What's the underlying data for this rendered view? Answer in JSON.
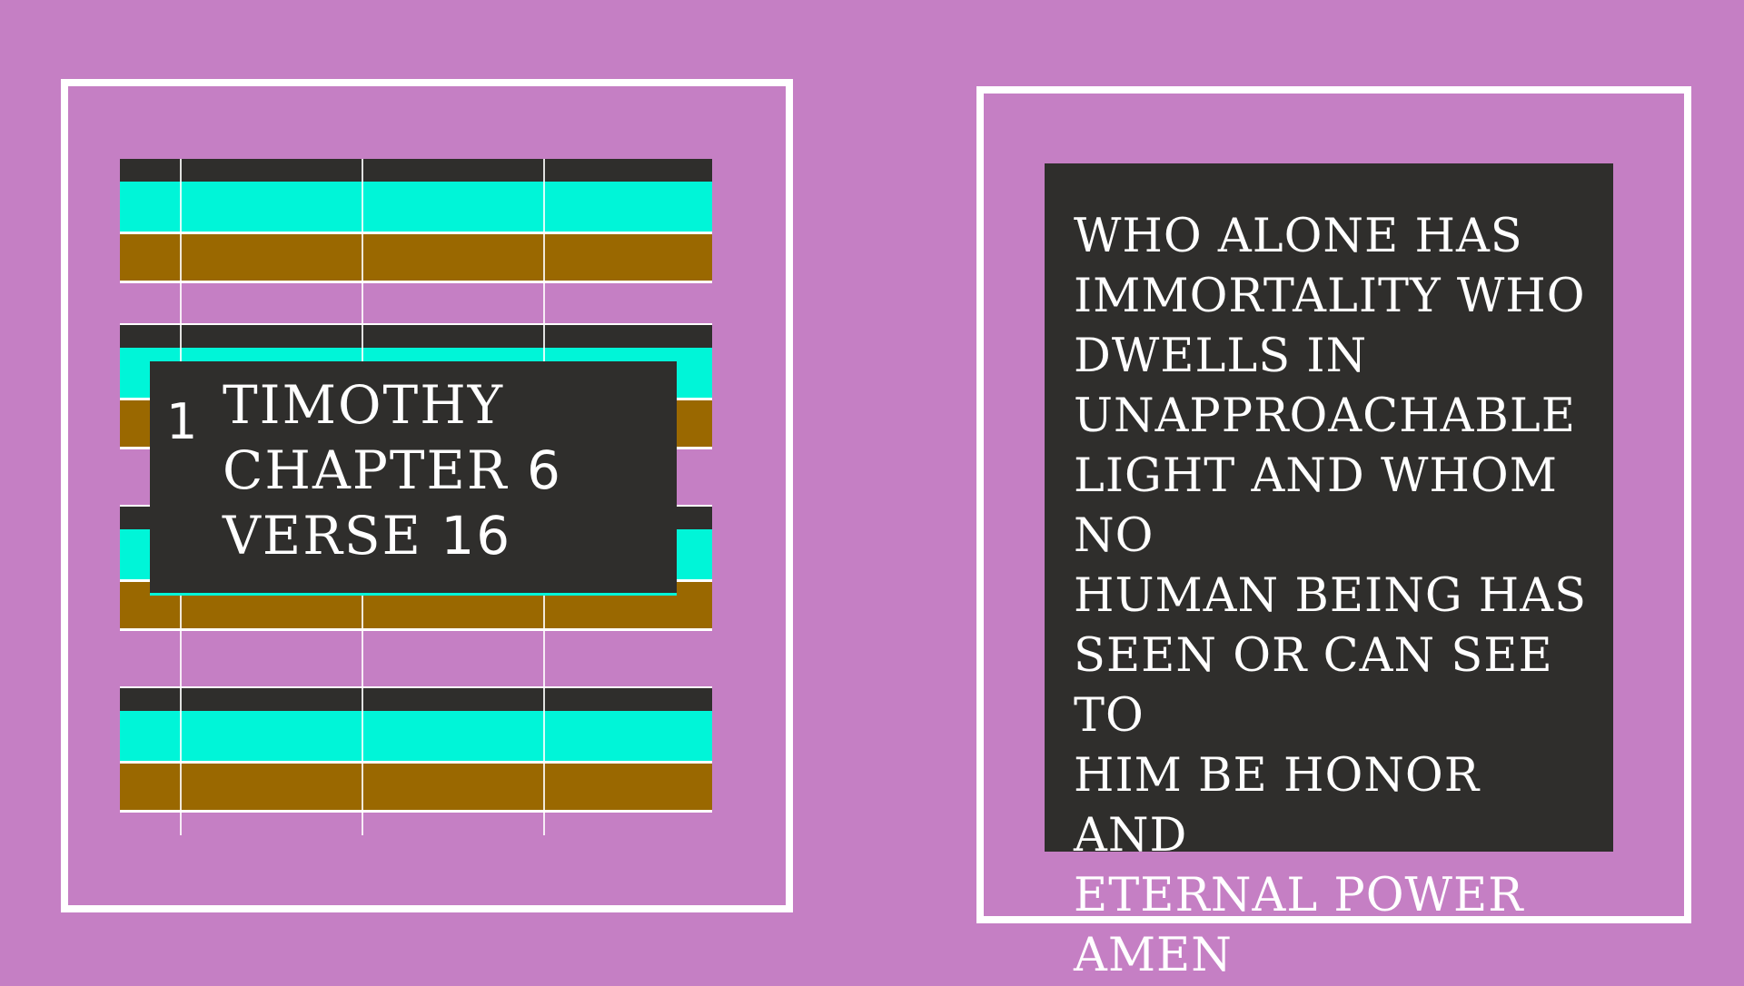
{
  "colors": {
    "background": "#c57fc4",
    "frame": "#ffffff",
    "panel": "#2f2e2c",
    "stripe_cyan": "#00f5d8",
    "stripe_brown": "#9a6800",
    "text": "#ffffff"
  },
  "reference": {
    "book_number": "1",
    "line1": "TIMOTHY",
    "line2_label": "CHAPTER ",
    "chapter": "6",
    "line3_label": "VERSE ",
    "verse": "16"
  },
  "verse_text": "WHO ALONE HAS\nIMMORTALITY  WHO\nDWELLS IN\nUNAPPROACHABLE\nLIGHT  AND WHOM NO\nHUMAN BEING HAS\nSEEN OR CAN SEE  TO\nHIM BE HONOR AND\nETERNAL POWER\nAMEN"
}
